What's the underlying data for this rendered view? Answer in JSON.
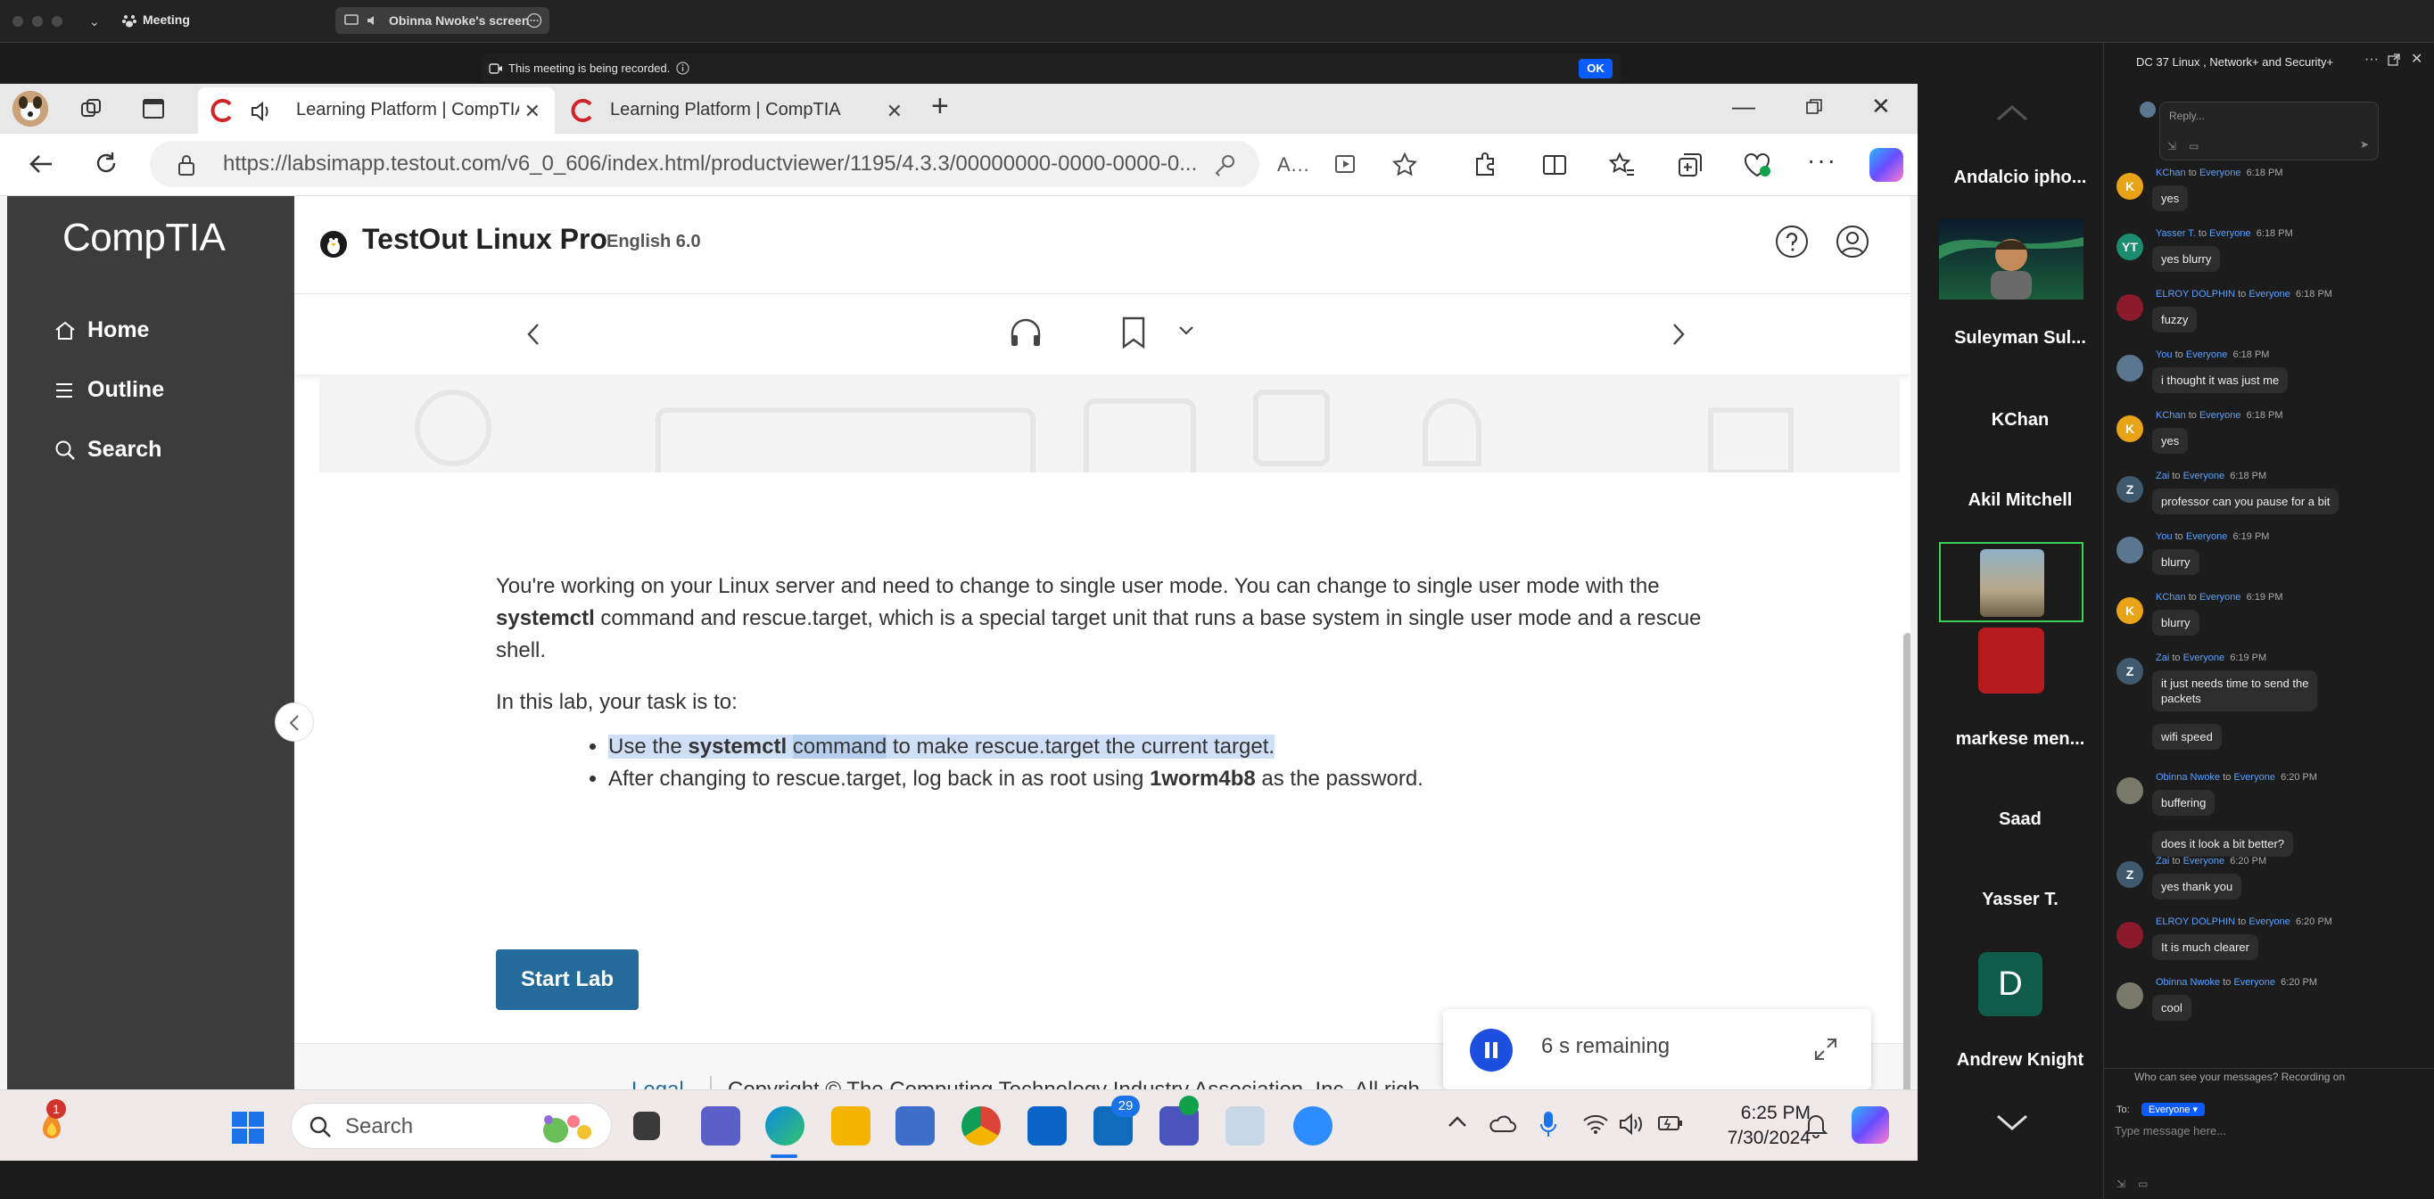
{
  "zoom": {
    "meeting_label": "Meeting",
    "screen_share_label": "Obinna Nwoke's screen",
    "recording_text": "This meeting is being recorded.",
    "ok_label": "OK"
  },
  "browser": {
    "tabs": [
      {
        "label": "Learning Platform | CompTIA"
      },
      {
        "label": "Learning Platform | CompTIA"
      }
    ],
    "url": "https://labsimapp.testout.com/v6_0_606/index.html/productviewer/1195/4.3.3/00000000-0000-0000-0..."
  },
  "sidebar": {
    "logo": "CompTIA",
    "items": [
      {
        "label": "Home",
        "icon": "home-icon"
      },
      {
        "label": "Outline",
        "icon": "list-icon"
      },
      {
        "label": "Search",
        "icon": "search-icon"
      }
    ]
  },
  "header": {
    "title": "TestOut Linux Pro",
    "version": "English 6.0"
  },
  "content": {
    "intro_pre": "You're working on your Linux server and need to change to single user mode. You can change to single user mode with the ",
    "intro_cmd": "systemctl",
    "intro_post": " command and rescue.target, which is a special target unit that runs a base system in single user mode and a rescue shell.",
    "task_intro": "In this lab, your task is to:",
    "task1_a": "Use the ",
    "task1_cmd": "systemctl",
    "task1_hl": "command",
    "task1_b": " to make rescue.target the current target.",
    "task2_a": "After changing to rescue.target, log back in as root using ",
    "task2_pw": "1worm4b8",
    "task2_b": " as the password.",
    "start_label": "Start Lab"
  },
  "footer": {
    "legal": "Legal",
    "copyright": "Copyright © The Computing Technology Industry Association, Inc. All righ"
  },
  "timer": {
    "text": "6 s remaining"
  },
  "taskbar": {
    "search_label": "Search",
    "notification_count": "1",
    "outlook_badge": "29",
    "time": "6:25 PM",
    "date": "7/30/2024"
  },
  "gallery": {
    "names": [
      "Andalcio ipho...",
      "Suleyman Sul...",
      "KChan",
      "Akil Mitchell",
      "markese men...",
      "Saad",
      "Yasser T.",
      "Andrew Knight"
    ],
    "d_avatar": "D"
  },
  "chat": {
    "title": "DC 37 Linux , Network+ and Security+",
    "reply_placeholder": "Reply...",
    "messages": [
      {
        "from": "KChan",
        "to": "Everyone",
        "time": "6:18 PM",
        "text": "yes",
        "avatar": "K",
        "color": "#e8a317"
      },
      {
        "from": "Yasser T.",
        "to": "Everyone",
        "time": "6:18 PM",
        "text": "yes blurry",
        "avatar": "YT",
        "color": "#1c8c6e"
      },
      {
        "from": "ELROY DOLPHIN",
        "to": "Everyone",
        "time": "6:18 PM",
        "text": "fuzzy",
        "avatar": "",
        "color": "#8b1a2b"
      },
      {
        "from": "You",
        "to": "Everyone",
        "time": "6:18 PM",
        "text": "i thought it was just me",
        "avatar": "",
        "color": "#5b7790"
      },
      {
        "from": "KChan",
        "to": "Everyone",
        "time": "6:18 PM",
        "text": "yes",
        "avatar": "K",
        "color": "#e8a317"
      },
      {
        "from": "Zai",
        "to": "Everyone",
        "time": "6:18 PM",
        "text": "professor can you pause for a bit",
        "avatar": "Z",
        "color": "#3f5a6e"
      },
      {
        "from": "You",
        "to": "Everyone",
        "time": "6:19 PM",
        "text": "blurry",
        "avatar": "",
        "color": "#5b7790"
      },
      {
        "from": "KChan",
        "to": "Everyone",
        "time": "6:19 PM",
        "text": "blurry",
        "avatar": "K",
        "color": "#e8a317"
      },
      {
        "from": "Zai",
        "to": "Everyone",
        "time": "6:19 PM",
        "text": "it just needs time to send the",
        "text2": "packets",
        "avatar": "Z",
        "color": "#3f5a6e"
      },
      {
        "from": "Obinna Nwoke",
        "to": "Everyone",
        "time": "6:20 PM",
        "text": "buffering",
        "avatar": "",
        "color": "#7a7a6a"
      },
      {
        "from": "Zai",
        "to": "Everyone",
        "time": "6:20 PM",
        "text": "yes thank you",
        "avatar": "Z",
        "color": "#3f5a6e"
      },
      {
        "from": "ELROY DOLPHIN",
        "to": "Everyone",
        "time": "6:20 PM",
        "text": "It is much clearer",
        "avatar": "",
        "color": "#8b1a2b"
      },
      {
        "from": "Obinna Nwoke",
        "to": "Everyone",
        "time": "6:20 PM",
        "text": "cool",
        "avatar": "",
        "color": "#7a7a6a"
      }
    ],
    "extra_bubbles": [
      "wifi speed",
      "does it look a bit better?"
    ],
    "to_word": "to",
    "privacy_note": "Who can see your messages? Recording on",
    "to_label": "To:",
    "to_value": "Everyone",
    "input_placeholder": "Type message here..."
  }
}
